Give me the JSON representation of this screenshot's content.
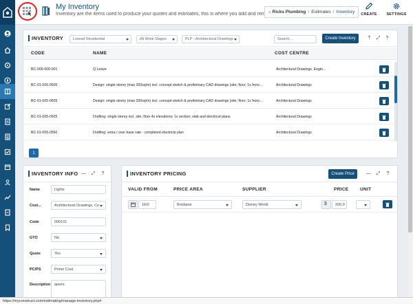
{
  "colors": {
    "primary": "#15507a",
    "accent": "#2a79b3",
    "danger": "#e02020",
    "background": "#eaeef2"
  },
  "sidebar": {
    "logo": "house-logo-icon",
    "items": [
      {
        "icon": "user-circle-icon"
      },
      {
        "icon": "home-icon"
      },
      {
        "icon": "dashboard-icon"
      },
      {
        "icon": "compass-icon"
      },
      {
        "icon": "book-icon",
        "active": true
      },
      {
        "icon": "edit-icon"
      },
      {
        "icon": "document-icon"
      },
      {
        "icon": "list-icon"
      },
      {
        "icon": "checkbox-icon"
      },
      {
        "icon": "calendar-icon"
      },
      {
        "icon": "people-icon"
      },
      {
        "icon": "chart-icon"
      },
      {
        "icon": "report-icon"
      },
      {
        "icon": "bookmark-icon"
      }
    ]
  },
  "topbar": {
    "title": "My Inventory",
    "description": "Inventory are the items used to produce your quotes and estimates, this is where you add and remove",
    "breadcrumb": {
      "home": "Ricks Plumbing",
      "section": "Estimates",
      "current": "Inventory"
    },
    "create_label": "CREATE",
    "settings_label": "SETTINGS"
  },
  "inventory": {
    "title": "INVENTORY",
    "filters": {
      "residential": "Lowset Residential",
      "work_stages": "All Work Stages",
      "cost_centre": "PLP - Architectural Drawings"
    },
    "search_placeholder": "Search...",
    "create_button": "Create Inventory",
    "columns": {
      "code": "CODE",
      "name": "NAME",
      "cost_centre": "COST CENTRE"
    },
    "rows": [
      {
        "code": "BC-000-000-001",
        "name": "Q Leave",
        "cost_centre": "Architectural Drawings, Engin..."
      },
      {
        "code": "BC-01-005-0505",
        "name": "Design: single storey (max 300sq/m) incl. concept sketch & preliminary CAD drawings (site; floor; 1x fronc...",
        "cost_centre": "Architectural Drawings"
      },
      {
        "code": "BC-01-005-0505",
        "name": "Design: single storey (max 300sq/m) incl. concept sketch & preliminary CAD drawings (site; floor; 1x fronc...",
        "cost_centre": "Architectural Drawings"
      },
      {
        "code": "BC-01-005-0525",
        "name": "Drafting: single storey incl. site; floor 4x elevations; 1x section; slab and electrical plans",
        "cost_centre": "Architectural Drawings"
      },
      {
        "code": "BC-01-005-0560",
        "name": "Drafting: extra / over base rate - completed electrical plan",
        "cost_centre": "Architectural Drawings"
      }
    ],
    "page": "1"
  },
  "info": {
    "title": "INVENTORY INFO",
    "fields": {
      "name_label": "Name",
      "name_value": "Lights",
      "cost_label": "Cost...",
      "cost_value": "Architectural Drawings, Co",
      "code_label": "Code",
      "code_value": "000101",
      "gto_label": "GTO",
      "gto_value": "No",
      "quote_label": "Quote",
      "quote_value": "Yes",
      "pcps_label": "PC/PS",
      "pcps_value": "Prime Cost",
      "desc_label": "Description",
      "desc_value": "qwers"
    }
  },
  "pricing": {
    "title": "INVENTORY PRICING",
    "create_button": "Create Price",
    "columns": {
      "valid_from": "VALID FROM",
      "price_area": "PRICE AREA",
      "supplier": "SUPPLIER",
      "price": "PRICE",
      "unit": "UNIT"
    },
    "row": {
      "valid_from": "16/0",
      "price_area": "Brisbane",
      "supplier": "Disney World",
      "currency": "$",
      "price": "200.0",
      "unit": ""
    }
  },
  "status_url": "https://myconstruct.com/estimating/manage-inventory.php#"
}
